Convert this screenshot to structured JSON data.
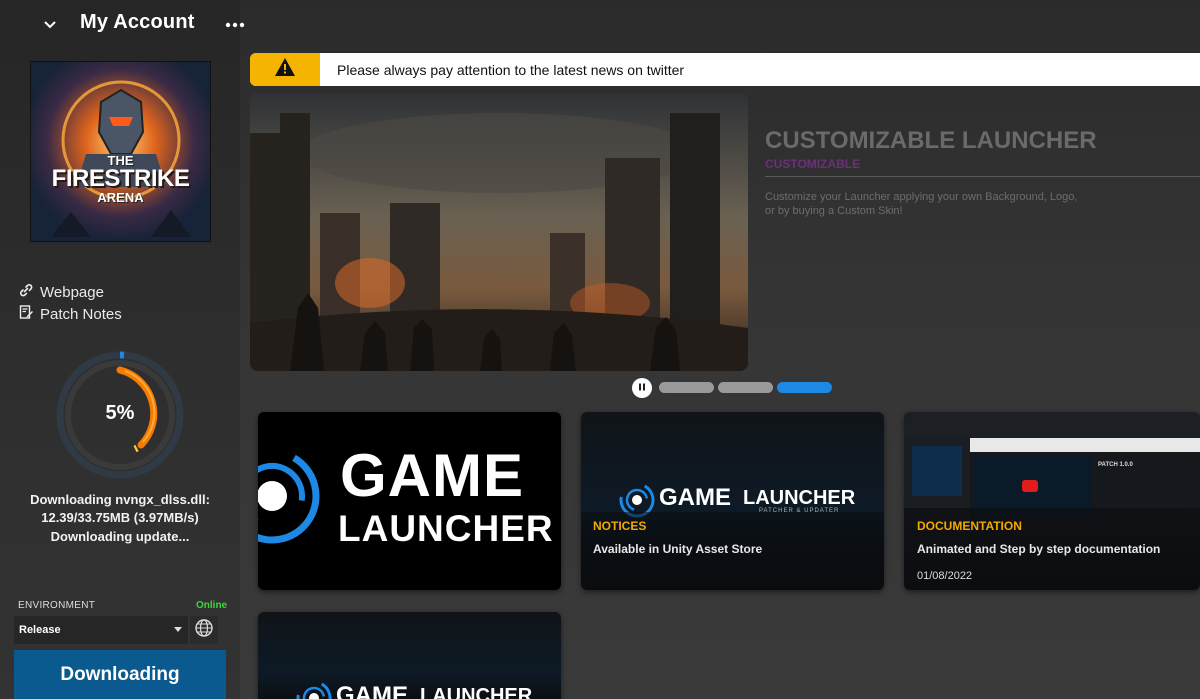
{
  "header": {
    "title": "My Account"
  },
  "game": {
    "logo_line1": "THE",
    "logo_line2": "FIRESTRIKE",
    "logo_line3": "ARENA"
  },
  "links": {
    "webpage": "Webpage",
    "patch_notes": "Patch Notes"
  },
  "progress": {
    "percent_text": "5%",
    "fraction": 0.05
  },
  "status": {
    "line1": "Downloading nvngx_dlss.dll:",
    "line2": "12.39/33.75MB (3.97MB/s)",
    "line3": "Downloading update..."
  },
  "environment": {
    "label": "ENVIRONMENT",
    "status": "Online",
    "selected": "Release"
  },
  "download_button": {
    "label": "Downloading"
  },
  "banner": {
    "text": "Please always pay attention to the latest news on twitter"
  },
  "hero": {
    "title": "CUSTOMIZABLE LAUNCHER",
    "subtitle": "CUSTOMIZABLE",
    "description": "Customize your Launcher applying your own Background, Logo, or by buying a Custom Skin!"
  },
  "carousel": {
    "count": 3,
    "active_index": 2
  },
  "cards": [
    {
      "logo_word1": "GAME",
      "logo_word2": "LAUNCHER"
    },
    {
      "logo_word1": "GAME",
      "logo_word2": "LAUNCHER",
      "logo_sub": "PATCHER & UPDATER",
      "tag": "NOTICES",
      "text": "Available in Unity Asset Store"
    },
    {
      "tag": "DOCUMENTATION",
      "text": "Animated and Step by step documentation",
      "date": "01/08/2022",
      "mini_patch": "PATCH 1.0.0"
    },
    {
      "logo_word1": "GAME",
      "logo_word2": "LAUNCHER"
    }
  ],
  "colors": {
    "accent_blue": "#1e88e5",
    "button_blue": "#0a5a8f",
    "warning_yellow": "#f5b400",
    "online_green": "#3fd43f",
    "tag_orange": "#f2a900",
    "progress_orange": "#f57c00"
  }
}
